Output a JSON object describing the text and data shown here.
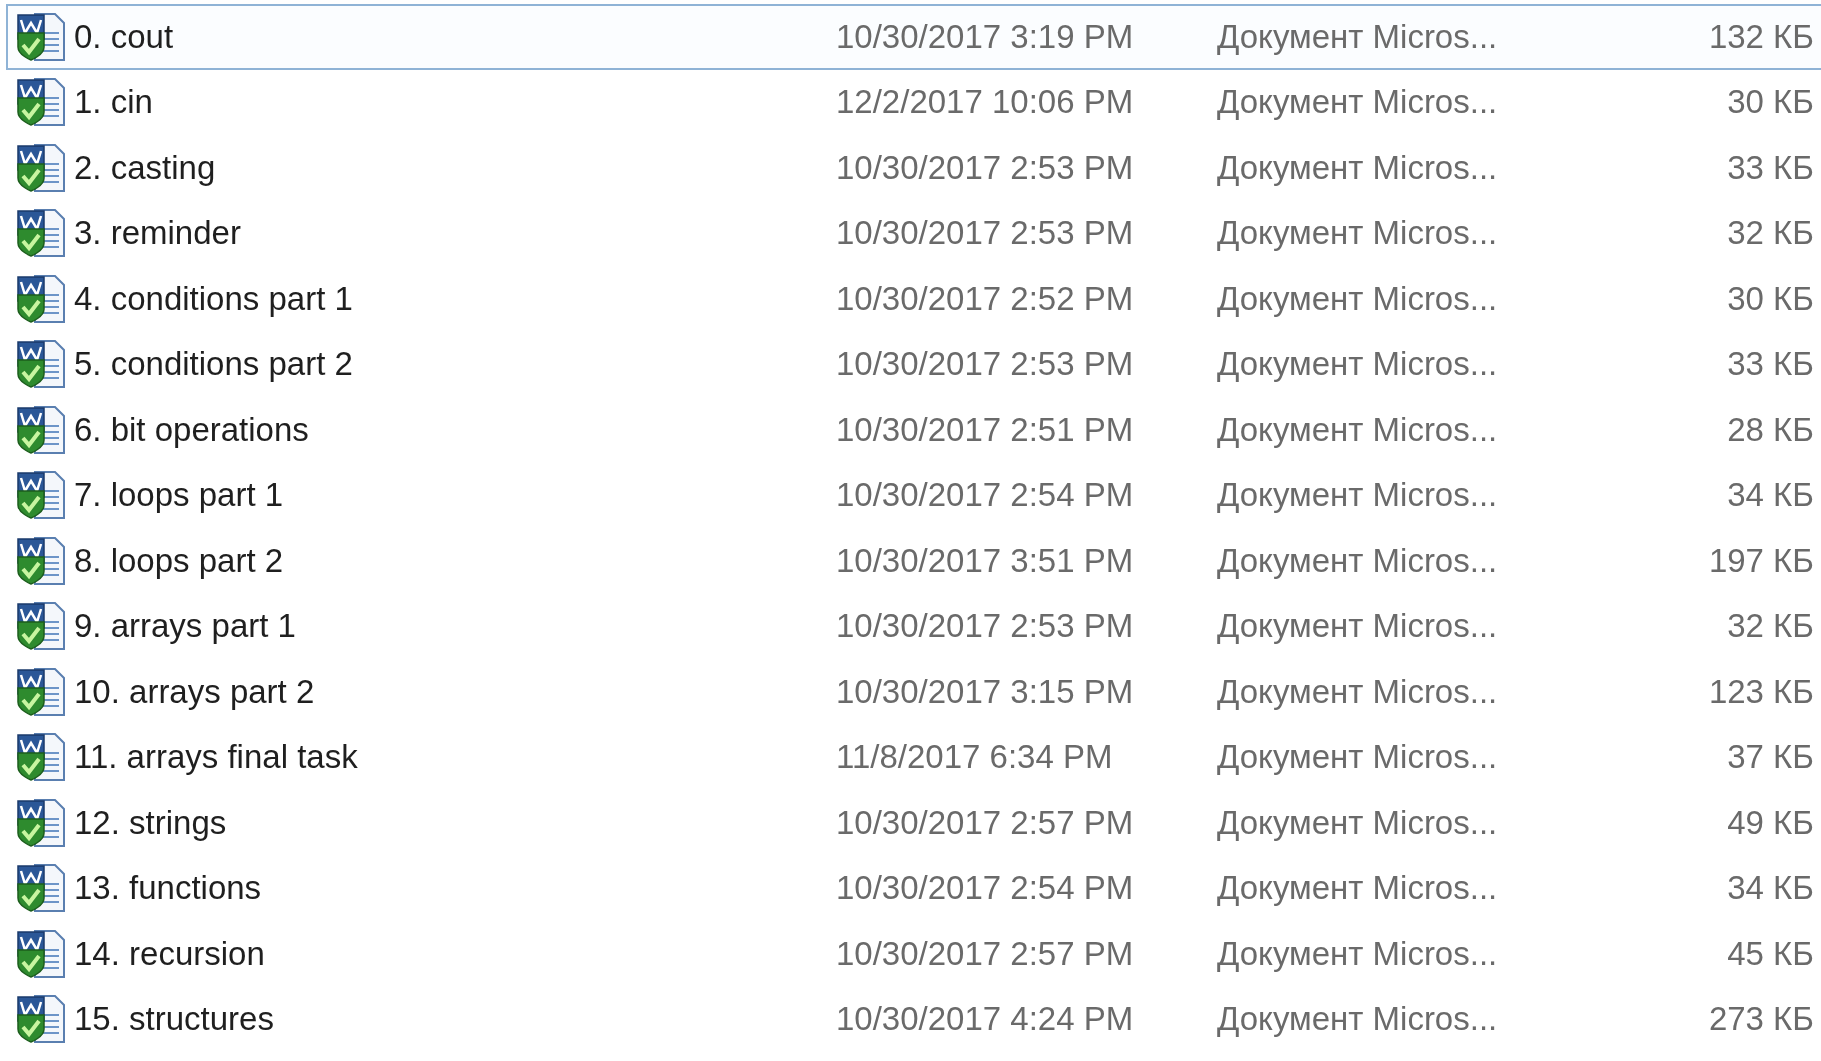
{
  "files": [
    {
      "name": "0. cout",
      "modified": "10/30/2017 3:19 PM",
      "type": "Документ Micros...",
      "size": "132 КБ",
      "selected": true
    },
    {
      "name": "1. cin",
      "modified": "12/2/2017 10:06 PM",
      "type": "Документ Micros...",
      "size": "30 КБ",
      "selected": false
    },
    {
      "name": "2. casting",
      "modified": "10/30/2017 2:53 PM",
      "type": "Документ Micros...",
      "size": "33 КБ",
      "selected": false
    },
    {
      "name": "3. reminder",
      "modified": "10/30/2017 2:53 PM",
      "type": "Документ Micros...",
      "size": "32 КБ",
      "selected": false
    },
    {
      "name": "4. conditions part 1",
      "modified": "10/30/2017 2:52 PM",
      "type": "Документ Micros...",
      "size": "30 КБ",
      "selected": false
    },
    {
      "name": "5. conditions part 2",
      "modified": "10/30/2017 2:53 PM",
      "type": "Документ Micros...",
      "size": "33 КБ",
      "selected": false
    },
    {
      "name": "6. bit operations",
      "modified": "10/30/2017 2:51 PM",
      "type": "Документ Micros...",
      "size": "28 КБ",
      "selected": false
    },
    {
      "name": "7. loops part 1",
      "modified": "10/30/2017 2:54 PM",
      "type": "Документ Micros...",
      "size": "34 КБ",
      "selected": false
    },
    {
      "name": "8. loops part 2",
      "modified": "10/30/2017 3:51 PM",
      "type": "Документ Micros...",
      "size": "197 КБ",
      "selected": false
    },
    {
      "name": "9. arrays part 1",
      "modified": "10/30/2017 2:53 PM",
      "type": "Документ Micros...",
      "size": "32 КБ",
      "selected": false
    },
    {
      "name": "10. arrays part 2",
      "modified": "10/30/2017 3:15 PM",
      "type": "Документ Micros...",
      "size": "123 КБ",
      "selected": false
    },
    {
      "name": "11. arrays final task",
      "modified": "11/8/2017 6:34 PM",
      "type": "Документ Micros...",
      "size": "37 КБ",
      "selected": false
    },
    {
      "name": "12. strings",
      "modified": "10/30/2017 2:57 PM",
      "type": "Документ Micros...",
      "size": "49 КБ",
      "selected": false
    },
    {
      "name": "13. functions",
      "modified": "10/30/2017 2:54 PM",
      "type": "Документ Micros...",
      "size": "34 КБ",
      "selected": false
    },
    {
      "name": "14. recursion",
      "modified": "10/30/2017 2:57 PM",
      "type": "Документ Micros...",
      "size": "45 КБ",
      "selected": false
    },
    {
      "name": "15. structures",
      "modified": "10/30/2017 4:24 PM",
      "type": "Документ Micros...",
      "size": "273 КБ",
      "selected": false
    }
  ]
}
